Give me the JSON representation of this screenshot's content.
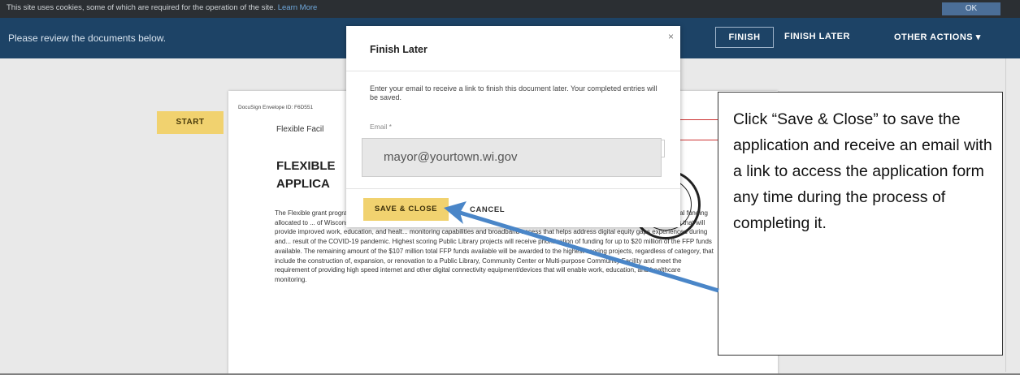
{
  "cookie_banner": {
    "text": "This site uses cookies, some of which are required for the operation of the site.",
    "link": "Learn More",
    "ok_label": "OK"
  },
  "header": {
    "message": "Please review the documents below.",
    "finish_label": "FINISH",
    "finish_later_label": "FINISH LATER",
    "other_actions_label": "OTHER ACTIONS ▾"
  },
  "start_label": "START",
  "document": {
    "envelope_id": "DocuSign Envelope ID: F6D551",
    "heading": "Flexible Facil",
    "title_line1": "FLEXIBLE",
    "title_line2": "APPLICA",
    "paragraph": "The Flexible grant progra (DOA) supported by up to $107 million in American R... Plan Act of 2021 (ARPA) Capital Projects Fund (CPF) federal funding allocated to ... of Wisconsin through the U.S. Department of Treasury. The Program aims to ... communities with funding facility improvements that will provide improved work, education, and healt... monitoring capabilities and broadband access that helps address digital equity gaps experienced during and... result of the COVID-19 pandemic. Highest scoring Public Library projects will receive prioritization of funding for up to $20 million of the FFP funds available. The remaining amount of the $107 million total FFP funds available will be awarded to the highest scoring projects, regardless of category, that include the construction of, expansion, or renovation to a Public Library, Community Center or Multi-purpose Community Facility and meet the requirement of providing high speed internet and other digital connectivity equipment/devices that will enable work, education, and healthcare monitoring."
  },
  "modal": {
    "title": "Finish Later",
    "close_label": "×",
    "description": "Enter your email to receive a link to finish this document later. Your completed entries will be saved.",
    "email_label": "Email *",
    "email_value": "mayor@yourtown.wi.gov",
    "save_label": "SAVE & CLOSE",
    "cancel_label": "CANCEL"
  },
  "callout": {
    "text": "Click “Save & Close” to save the application and receive an email with a link to access the application form any time during the process of completing it."
  },
  "colors": {
    "header_bg": "#1d4366",
    "button_yellow": "#f1d26f",
    "arrow_blue": "#4a86c8"
  }
}
